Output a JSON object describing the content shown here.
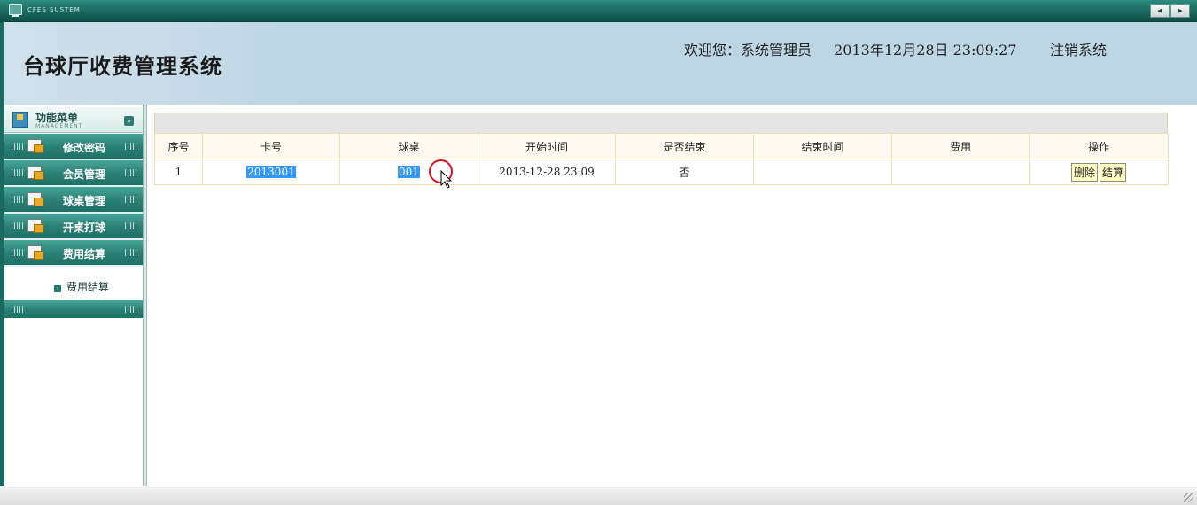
{
  "window": {
    "system_name": "CFES SUSTEM"
  },
  "header": {
    "app_title": "台球厅收费管理系统",
    "welcome_label": "欢迎您：系统管理员",
    "datetime": "2013年12月28日  23:09:27",
    "logout_label": "注销系统"
  },
  "sidebar": {
    "menu_title": "功能菜单",
    "menu_subtitle": "MANAGEMENT",
    "items": [
      {
        "label": "修改密码"
      },
      {
        "label": "会员管理"
      },
      {
        "label": "球桌管理"
      },
      {
        "label": "开桌打球"
      },
      {
        "label": "费用结算"
      }
    ],
    "sub_item": "费用结算"
  },
  "table": {
    "headers": [
      "序号",
      "卡号",
      "球桌",
      "开始时间",
      "是否结束",
      "结束时间",
      "费用",
      "操作"
    ],
    "rows": [
      {
        "index": "1",
        "card": "2013001",
        "table_no": "001",
        "start": "2013-12-28 23:09",
        "finished": "否",
        "end": "",
        "fee": ""
      }
    ],
    "actions": {
      "delete": "删除",
      "settle": "结算"
    }
  },
  "colors": {
    "teal": "#2c8276",
    "header_bg": "#bcd6e4",
    "button_bg": "#ffffc6",
    "selection": "#3399ff"
  }
}
